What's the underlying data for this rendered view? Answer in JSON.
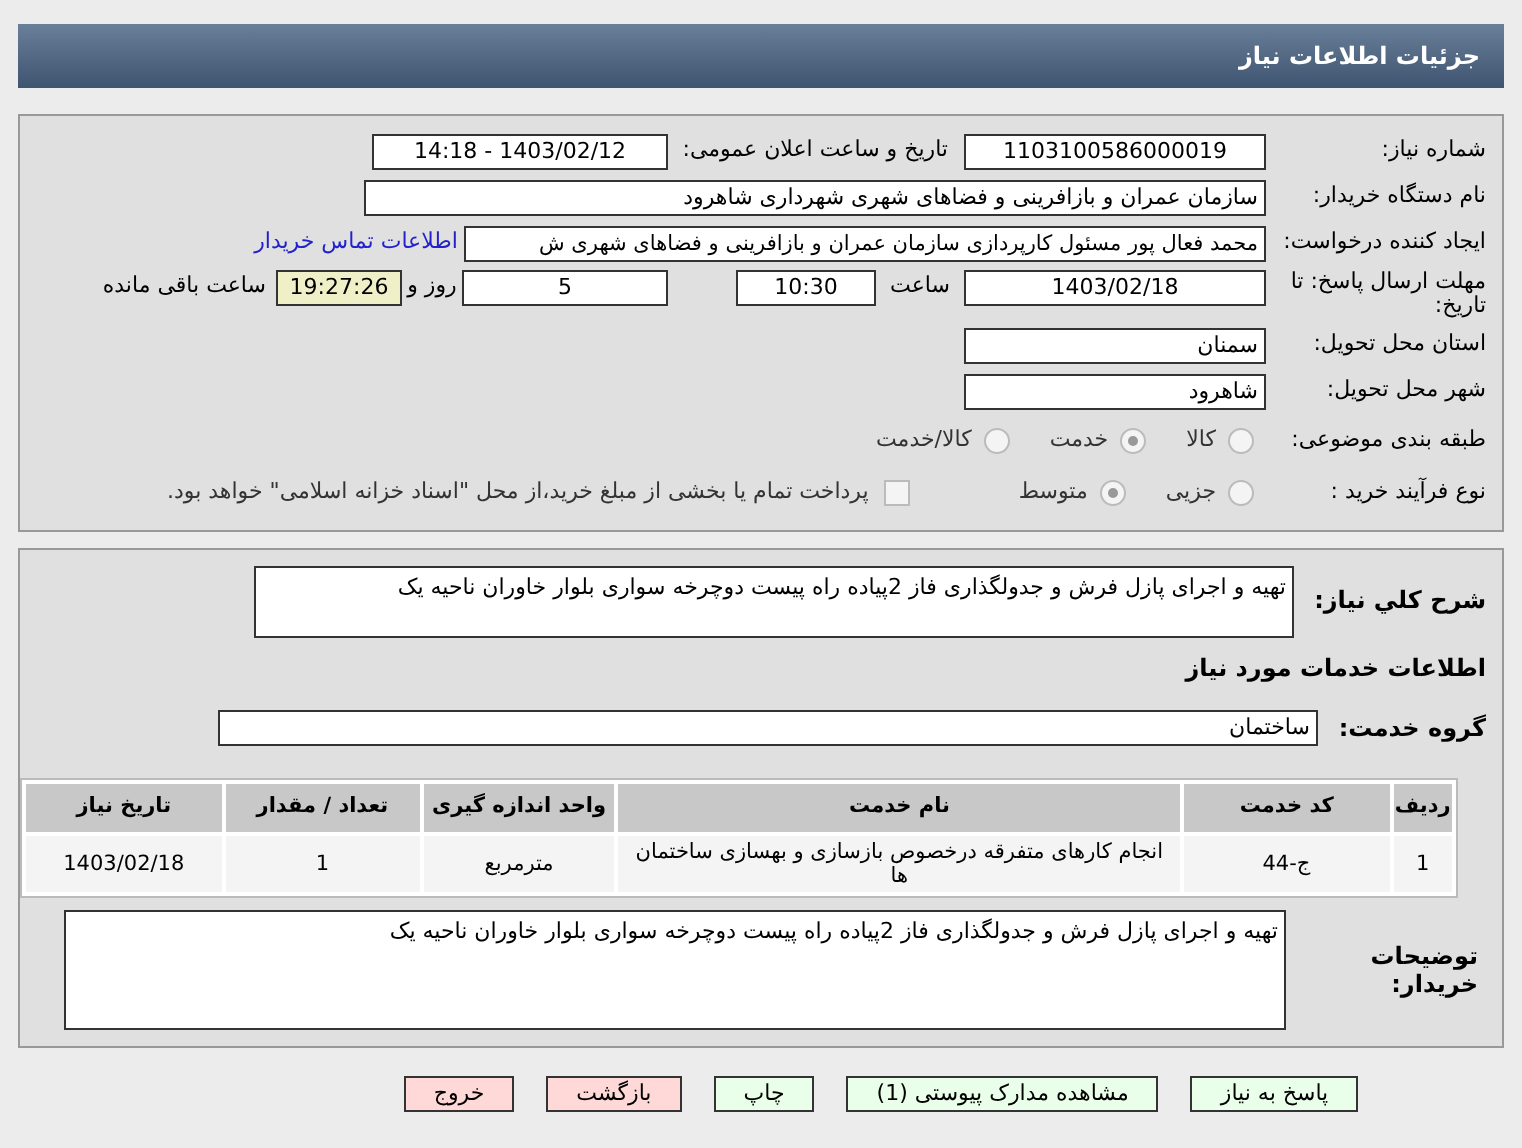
{
  "header": {
    "title": "جزئیات اطلاعات نیاز"
  },
  "need_number": {
    "label": "شماره نیاز:",
    "value": "1103100586000019"
  },
  "announce": {
    "label": "تاریخ و ساعت اعلان عمومی:",
    "value": "1403/02/12 - 14:18"
  },
  "buyer_org": {
    "label": "نام دستگاه خریدار:",
    "value": "سازمان عمران و بازافرینی و فضاهای شهری شهرداری شاهرود"
  },
  "requester": {
    "label": "ایجاد کننده درخواست:",
    "value": "محمد فعال پور مسئول کارپردازی سازمان عمران و بازافرینی و فضاهای شهری ش",
    "link": "اطلاعات تماس خریدار"
  },
  "deadline": {
    "label": "مهلت ارسال پاسخ: تا تاریخ:",
    "date": "1403/02/18",
    "time_label": "ساعت",
    "time": "10:30",
    "days": "5",
    "days_label": "روز و",
    "remaining": "19:27:26",
    "remaining_label": "ساعت باقی مانده"
  },
  "province": {
    "label": "استان محل تحویل:",
    "value": "سمنان"
  },
  "city": {
    "label": "شهر محل تحویل:",
    "value": "شاهرود"
  },
  "category": {
    "label": "طبقه بندی موضوعی:",
    "options": [
      {
        "label": "کالا",
        "selected": false
      },
      {
        "label": "خدمت",
        "selected": true
      },
      {
        "label": "کالا/خدمت",
        "selected": false
      }
    ]
  },
  "process": {
    "label": "نوع فرآیند خرید :",
    "options": [
      {
        "label": "جزیی",
        "selected": false
      },
      {
        "label": "متوسط",
        "selected": true
      }
    ],
    "payment": {
      "label": "پرداخت تمام یا بخشی از مبلغ خرید،از محل \"اسناد خزانه اسلامی\" خواهد بود.",
      "checked": false
    }
  },
  "description": {
    "label": "شرح کلي نياز:",
    "value": "تهیه و اجرای پازل فرش و جدولگذاری فاز 2پیاده راه پیست دوچرخه سواری بلوار خاوران ناحیه یک"
  },
  "services_title": "اطلاعات خدمات مورد نیاز",
  "service_group": {
    "label": "گروه خدمت:",
    "value": "ساختمان"
  },
  "table": {
    "columns": [
      "ردیف",
      "کد خدمت",
      "نام خدمت",
      "واحد اندازه گیری",
      "تعداد / مقدار",
      "تاریخ نیاز"
    ],
    "rows": [
      [
        "1",
        "ج-44",
        "انجام کارهای متفرقه درخصوص بازسازی و بهسازی ساختمان ها",
        "مترمربع",
        "1",
        "1403/02/18"
      ]
    ]
  },
  "buyer_notes": {
    "label": "توضیحات خریدار:",
    "value": "تهیه و اجرای پازل فرش و جدولگذاری فاز 2پیاده راه پیست دوچرخه سواری بلوار خاوران ناحیه یک"
  },
  "buttons": [
    {
      "label": "پاسخ به نیاز",
      "kind": "green"
    },
    {
      "label": "مشاهده مدارک پیوستی (1)",
      "kind": "green"
    },
    {
      "label": "چاپ",
      "kind": "green"
    },
    {
      "label": "بازگشت",
      "kind": "red"
    },
    {
      "label": "خروج",
      "kind": "red"
    }
  ]
}
